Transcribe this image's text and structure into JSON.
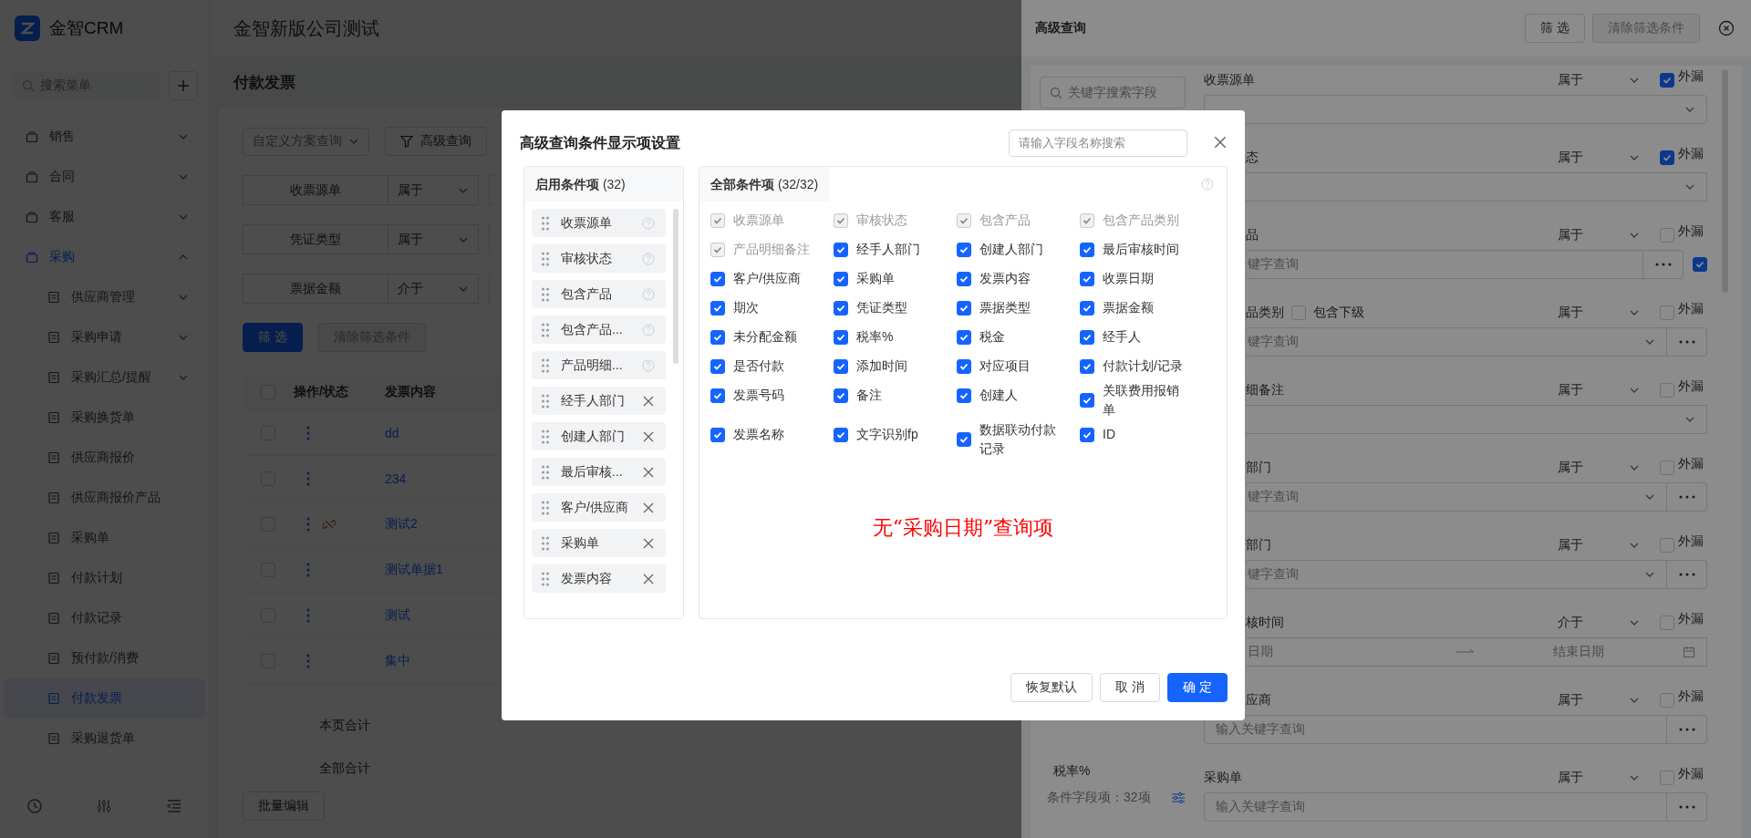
{
  "header": {
    "logo": "金智CRM",
    "company": "金智新版公司测试"
  },
  "sidebar": {
    "search_placeholder": "搜索菜单",
    "items": [
      {
        "label": "销售",
        "expanded": false,
        "selected": false
      },
      {
        "label": "合同",
        "expanded": false,
        "selected": false
      },
      {
        "label": "客服",
        "expanded": false,
        "selected": false
      },
      {
        "label": "采购",
        "expanded": true,
        "selected": true,
        "children": [
          {
            "label": "供应商管理",
            "expanded": false,
            "selected": false
          },
          {
            "label": "采购申请",
            "expanded": false,
            "selected": false
          },
          {
            "label": "采购汇总/提醒",
            "expanded": false,
            "selected": false
          },
          {
            "label": "采购换货单",
            "selected": false
          },
          {
            "label": "供应商报价",
            "selected": false
          },
          {
            "label": "供应商报价产品",
            "selected": false
          },
          {
            "label": "采购单",
            "selected": false
          },
          {
            "label": "付款计划",
            "selected": false
          },
          {
            "label": "付款记录",
            "selected": false
          },
          {
            "label": "预付款/消费",
            "selected": false
          },
          {
            "label": "付款发票",
            "selected": true
          },
          {
            "label": "采购退货单",
            "selected": false
          }
        ]
      }
    ]
  },
  "page": {
    "title": "付款发票",
    "scheme_placeholder": "自定义方案查询",
    "advanced_button": "高级查询",
    "filters": [
      {
        "field": "收票源单",
        "operator": "属于"
      },
      {
        "field": "凭证类型",
        "operator": "属于"
      },
      {
        "field": "票据金额",
        "operator": "介于"
      }
    ],
    "filter_button": "筛 选",
    "clear_button": {
      "label": "清除筛选条件",
      "disabled": true
    },
    "table": {
      "select_all_checked": false,
      "columns": [
        "操作/状态",
        "发票内容"
      ],
      "rows": [
        {
          "content": "dd",
          "checked": false,
          "unlinked": false
        },
        {
          "content": "234",
          "checked": false,
          "unlinked": false
        },
        {
          "content": "测试2",
          "checked": false,
          "unlinked": true
        },
        {
          "content": "测试单据1",
          "checked": false,
          "unlinked": false
        },
        {
          "content": "测试",
          "checked": false,
          "unlinked": false
        },
        {
          "content": "集中",
          "checked": false,
          "unlinked": false
        }
      ]
    },
    "totals": [
      "本页合计",
      "全部合计"
    ],
    "batch_button": "批量编辑"
  },
  "drawer": {
    "title": "高级查询",
    "filter_button": "筛 选",
    "clear_button": {
      "label": "清除筛选条件",
      "disabled": true
    },
    "search_placeholder": "关键字搜索字段",
    "field_list": [
      "税率%"
    ],
    "field_count": "条件字段项：32项",
    "fields": [
      {
        "label": "收票源单",
        "operator": "属于",
        "leak_label": "外漏",
        "leak_checked": true,
        "input": {
          "kind": "select"
        }
      },
      {
        "label": "态",
        "covered": true,
        "operator": "属于",
        "leak_label": "外漏",
        "leak_checked": true,
        "input": {
          "kind": "select",
          "covered": true
        }
      },
      {
        "label": "品",
        "covered": true,
        "operator": "属于",
        "leak_label": "外漏",
        "leak_checked": false,
        "input": {
          "kind": "lookup",
          "placeholder": "键字查询",
          "covered": true,
          "extra_checked": true
        }
      },
      {
        "label": "品类别",
        "covered": true,
        "include_sub": {
          "label": "包含下级",
          "checked": false
        },
        "operator": "属于",
        "leak_label": "外漏",
        "leak_checked": false,
        "input": {
          "kind": "select_lookup",
          "placeholder": "键字查询",
          "covered": true
        }
      },
      {
        "label": "细备注",
        "covered": true,
        "operator": "属于",
        "leak_label": "外漏",
        "leak_checked": false,
        "input": {
          "kind": "select",
          "covered": true
        }
      },
      {
        "label": "部门",
        "covered": true,
        "operator": "属于",
        "leak_label": "外漏",
        "leak_checked": false,
        "input": {
          "kind": "select_lookup",
          "placeholder": "键字查询",
          "covered": true
        }
      },
      {
        "label": "部门",
        "covered": true,
        "operator": "属于",
        "leak_label": "外漏",
        "leak_checked": false,
        "input": {
          "kind": "select_lookup",
          "placeholder": "键字查询",
          "covered": true
        }
      },
      {
        "label": "核时间",
        "covered": true,
        "operator": "介于",
        "leak_label": "外漏",
        "leak_checked": false,
        "input": {
          "kind": "date_range",
          "placeholder": "日期",
          "end_placeholder": "结束日期",
          "covered": true
        }
      },
      {
        "label": "应商",
        "covered": true,
        "operator": "属于",
        "leak_label": "外漏",
        "leak_checked": false,
        "input": {
          "kind": "lookup",
          "placeholder": "输入关键字查询",
          "covered": false
        }
      },
      {
        "label": "采购单",
        "operator": "属于",
        "leak_label": "外漏",
        "leak_checked": false,
        "input": {
          "kind": "lookup",
          "placeholder": "输入关键字查询",
          "covered": false
        }
      }
    ]
  },
  "modal": {
    "title": "高级查询条件显示项设置",
    "search_placeholder": "请输入字段名称搜索",
    "enabled": {
      "title": "**启用条件项** (32)",
      "items": [
        {
          "label": "收票源单",
          "kind": "locked"
        },
        {
          "label": "审核状态",
          "kind": "locked"
        },
        {
          "label": "包含产品",
          "kind": "locked"
        },
        {
          "label": "包含产品...",
          "kind": "locked"
        },
        {
          "label": "产品明细...",
          "kind": "locked"
        },
        {
          "label": "经手人部门",
          "kind": "removable"
        },
        {
          "label": "创建人部门",
          "kind": "removable"
        },
        {
          "label": "最后审核...",
          "kind": "removable"
        },
        {
          "label": "客户/供应商",
          "kind": "removable"
        },
        {
          "label": "采购单",
          "kind": "removable"
        },
        {
          "label": "发票内容",
          "kind": "removable"
        }
      ]
    },
    "all": {
      "title": "**全部条件项** (32/32)",
      "items": [
        {
          "label": "收票源单",
          "checked": true,
          "disabled": true
        },
        {
          "label": "审核状态",
          "checked": true,
          "disabled": true
        },
        {
          "label": "包含产品",
          "checked": true,
          "disabled": true
        },
        {
          "label": "包含产品类别",
          "checked": true,
          "disabled": true
        },
        {
          "label": "产品明细备注",
          "checked": true,
          "disabled": true
        },
        {
          "label": "经手人部门",
          "checked": true,
          "disabled": false
        },
        {
          "label": "创建人部门",
          "checked": true,
          "disabled": false
        },
        {
          "label": "最后审核时间",
          "checked": true,
          "disabled": false
        },
        {
          "label": "客户/供应商",
          "checked": true,
          "disabled": false
        },
        {
          "label": "采购单",
          "checked": true,
          "disabled": false
        },
        {
          "label": "发票内容",
          "checked": true,
          "disabled": false
        },
        {
          "label": "收票日期",
          "checked": true,
          "disabled": false
        },
        {
          "label": "期次",
          "checked": true,
          "disabled": false
        },
        {
          "label": "凭证类型",
          "checked": true,
          "disabled": false
        },
        {
          "label": "票据类型",
          "checked": true,
          "disabled": false
        },
        {
          "label": "票据金额",
          "checked": true,
          "disabled": false
        },
        {
          "label": "未分配金额",
          "checked": true,
          "disabled": false
        },
        {
          "label": "税率%",
          "checked": true,
          "disabled": false
        },
        {
          "label": "税金",
          "checked": true,
          "disabled": false
        },
        {
          "label": "经手人",
          "checked": true,
          "disabled": false
        },
        {
          "label": "是否付款",
          "checked": true,
          "disabled": false
        },
        {
          "label": "添加时间",
          "checked": true,
          "disabled": false
        },
        {
          "label": "对应项目",
          "checked": true,
          "disabled": false
        },
        {
          "label": "付款计划/记录",
          "checked": true,
          "disabled": false
        },
        {
          "label": "发票号码",
          "checked": true,
          "disabled": false
        },
        {
          "label": "备注",
          "checked": true,
          "disabled": false
        },
        {
          "label": "创建人",
          "checked": true,
          "disabled": false
        },
        {
          "label": "关联费用报销单",
          "checked": true,
          "disabled": false
        },
        {
          "label": "发票名称",
          "checked": true,
          "disabled": false
        },
        {
          "label": "文字识别fp",
          "checked": true,
          "disabled": false
        },
        {
          "label": "数据联动付款记录",
          "checked": true,
          "disabled": false
        },
        {
          "label": "ID",
          "checked": true,
          "disabled": false
        }
      ]
    },
    "note": "无“采购日期”查询项",
    "buttons": [
      {
        "label": "恢复默认",
        "kind": "default"
      },
      {
        "label": "取 消",
        "kind": "default"
      },
      {
        "label": "确 定",
        "kind": "primary"
      }
    ]
  }
}
